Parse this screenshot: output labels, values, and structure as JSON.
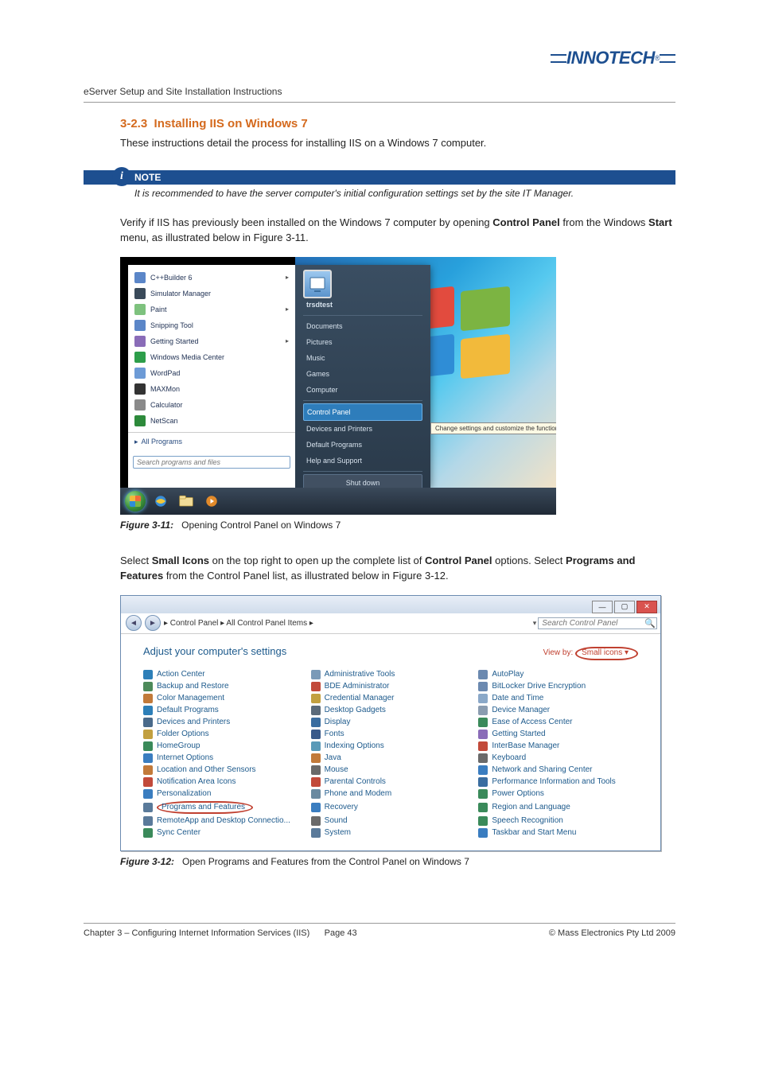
{
  "brand": {
    "name": "INNOTECH",
    "reg": "®"
  },
  "doc_title": "eServer Setup and Site Installation Instructions",
  "section": {
    "number": "3-2.3",
    "title": "Installing IIS on Windows 7",
    "intro": "These instructions detail the process for installing IIS on a Windows 7 computer."
  },
  "note": {
    "label": "NOTE",
    "body": "It is recommended to have the server computer's initial configuration settings set by the site IT Manager."
  },
  "para1": {
    "pre": "Verify if IIS has previously been installed on the Windows 7 computer by opening ",
    "b1": "Control Panel",
    "mid": " from the Windows ",
    "b2": "Start",
    "post": " menu, as illustrated below in Figure 3-11."
  },
  "fig311": {
    "label": "Figure 3-11:",
    "caption": "Opening Control Panel on Windows 7",
    "search_placeholder": "Search programs and files",
    "left_items": [
      {
        "label": "C++Builder 6",
        "arrow": true,
        "color": "#5b86c8"
      },
      {
        "label": "Simulator Manager",
        "arrow": false,
        "color": "#3a4a5a"
      },
      {
        "label": "Paint",
        "arrow": true,
        "color": "#7ec27e"
      },
      {
        "label": "Snipping Tool",
        "arrow": false,
        "color": "#5b86c8"
      },
      {
        "label": "Getting Started",
        "arrow": true,
        "color": "#8a6cb8"
      },
      {
        "label": "Windows Media Center",
        "arrow": false,
        "color": "#2d9e4a"
      },
      {
        "label": "WordPad",
        "arrow": false,
        "color": "#6d9bd6"
      },
      {
        "label": "MAXMon",
        "arrow": false,
        "color": "#333"
      },
      {
        "label": "Calculator",
        "arrow": false,
        "color": "#8a8a8a"
      },
      {
        "label": "NetScan",
        "arrow": false,
        "color": "#2d8a3b"
      }
    ],
    "all_programs": "All Programs",
    "right_user": "trsdtest",
    "right_items_1": [
      "Documents",
      "Pictures",
      "Music",
      "Games",
      "Computer"
    ],
    "right_highlight": "Control Panel",
    "right_items_2": [
      "Devices and Printers",
      "Default Programs",
      "Help and Support"
    ],
    "shutdown": "Shut down",
    "tooltip": "Change settings and customize the functionality of your computer."
  },
  "para2": {
    "pre": "Select ",
    "b1": "Small Icons",
    "mid1": " on the top right to open up the complete list of ",
    "b2": "Control Panel",
    "mid2": " options.  Select ",
    "b3": "Programs and Features",
    "post": " from the Control Panel list, as illustrated below in Figure 3-12."
  },
  "fig312": {
    "label": "Figure 3-12:",
    "caption": "Open Programs and Features from the Control Panel on Windows 7",
    "breadcrumb": "▸ Control Panel ▸ All Control Panel Items ▸",
    "search_placeholder": "Search Control Panel",
    "adjust": "Adjust your computer's settings",
    "view_by_label": "View by:",
    "view_by_value": "Small icons ▾",
    "items": [
      [
        "Action Center",
        "#2d7fb8"
      ],
      [
        "Administrative Tools",
        "#7a9ab8"
      ],
      [
        "AutoPlay",
        "#6b89b0"
      ],
      [
        "Backup and Restore",
        "#4d8a5a"
      ],
      [
        "BDE Administrator",
        "#c24a3a"
      ],
      [
        "BitLocker Drive Encryption",
        "#6b89b0"
      ],
      [
        "Color Management",
        "#c27a3a"
      ],
      [
        "Credential Manager",
        "#c2a040"
      ],
      [
        "Date and Time",
        "#8aa8c8"
      ],
      [
        "Default Programs",
        "#2d7fb8"
      ],
      [
        "Desktop Gadgets",
        "#5a6a7a"
      ],
      [
        "Device Manager",
        "#8a9cb0"
      ],
      [
        "Devices and Printers",
        "#4a6a8a"
      ],
      [
        "Display",
        "#3a6da0"
      ],
      [
        "Ease of Access Center",
        "#3a8a5a"
      ],
      [
        "Folder Options",
        "#c2a040"
      ],
      [
        "Fonts",
        "#3a5a8a"
      ],
      [
        "Getting Started",
        "#8a6cb8"
      ],
      [
        "HomeGroup",
        "#3a8a5a"
      ],
      [
        "Indexing Options",
        "#5a9ab8"
      ],
      [
        "InterBase Manager",
        "#c24a3a"
      ],
      [
        "Internet Options",
        "#3a7dc0"
      ],
      [
        "Java",
        "#c27a3a"
      ],
      [
        "Keyboard",
        "#6a6a6a"
      ],
      [
        "Location and Other Sensors",
        "#c27a3a"
      ],
      [
        "Mouse",
        "#6a6a6a"
      ],
      [
        "Network and Sharing Center",
        "#3a7dc0"
      ],
      [
        "Notification Area Icons",
        "#c24a3a"
      ],
      [
        "Parental Controls",
        "#c24a3a"
      ],
      [
        "Performance Information and Tools",
        "#3a6da0"
      ],
      [
        "Personalization",
        "#3a7dc0"
      ],
      [
        "Phone and Modem",
        "#6a8aa0"
      ],
      [
        "Power Options",
        "#3a8a5a"
      ],
      [
        "Programs and Features",
        "#5a7a9a"
      ],
      [
        "Recovery",
        "#3a7dc0"
      ],
      [
        "Region and Language",
        "#3a8a5a"
      ],
      [
        "RemoteApp and Desktop Connectio...",
        "#5a7a9a"
      ],
      [
        "Sound",
        "#6a6a6a"
      ],
      [
        "Speech Recognition",
        "#3a8a5a"
      ],
      [
        "Sync Center",
        "#3a8a5a"
      ],
      [
        "System",
        "#5a7a9a"
      ],
      [
        "Taskbar and Start Menu",
        "#3a7dc0"
      ]
    ]
  },
  "footer": {
    "left": "Chapter 3 – Configuring Internet Information Services (IIS)",
    "page": "Page 43",
    "right": "© Mass Electronics Pty Ltd  2009"
  }
}
